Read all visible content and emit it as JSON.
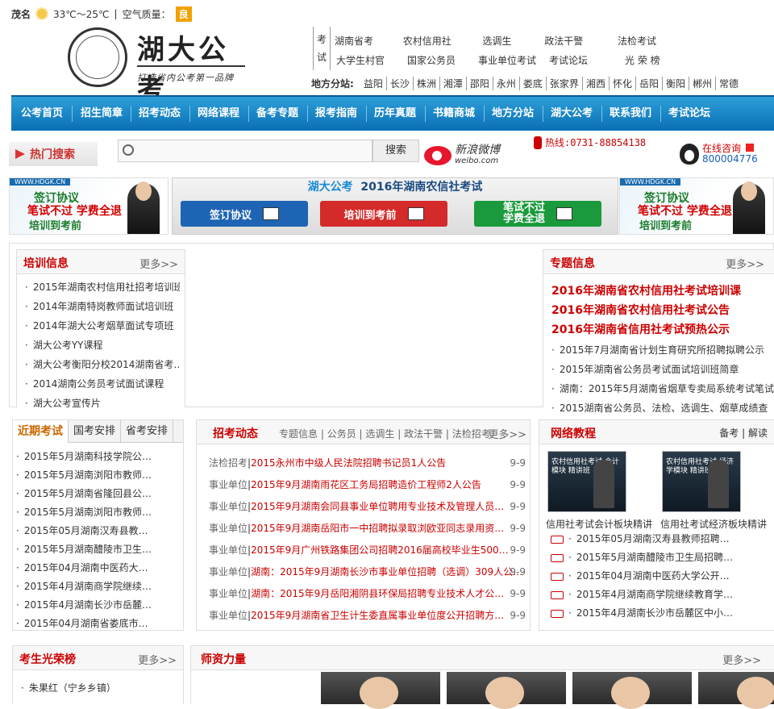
{
  "weather": {
    "city": "茂名",
    "temp": "33℃～25℃",
    "aq_label": "空气质量：",
    "aq_value": "良"
  },
  "logo": {
    "brand": "湖大公考",
    "slogan": "打造省内公考第一品牌"
  },
  "exam_label": [
    "考",
    "试"
  ],
  "topnav": {
    "row1": [
      "湖南省考",
      "农村信用社",
      "选调生",
      "政法干警",
      "法检考试"
    ],
    "row2": [
      "大学生村官",
      "国家公务员",
      "事业单位考试",
      "考试论坛",
      "光 荣 榜"
    ]
  },
  "region": {
    "label": "地方分站:",
    "cities": [
      "益阳",
      "长沙",
      "株洲",
      "湘潭",
      "邵阳",
      "永州",
      "娄底",
      "张家界",
      "湘西",
      "怀化",
      "岳阳",
      "衡阳",
      "郴州",
      "常德"
    ]
  },
  "mainnav": [
    "公考首页",
    "招生简章",
    "招考动态",
    "网络课程",
    "备考专题",
    "报考指南",
    "历年真题",
    "书籍商城",
    "地方分站",
    "湖大公考",
    "联系我们",
    "考试论坛"
  ],
  "search": {
    "hot": "热门搜索",
    "button": "搜索",
    "weibo_cn": "新浪微博",
    "weibo_en": "weibo.com",
    "hotline": "热线:0731-88854138",
    "qq_label": "在线咨询",
    "qq_num": "800004776"
  },
  "sidebanner": {
    "tag": "WWW.HDGK.CN",
    "t1": "签订协议",
    "t2": "笔试不过 学费全退",
    "t3": "培训到考前"
  },
  "cbanner": {
    "brand": "湖大公考",
    "title": "2016年湖南农信社考试",
    "btns": [
      "签订协议",
      "培训到考前",
      "笔试不过\n学费全退"
    ]
  },
  "colors": {
    "nav": "#0a6fb5",
    "accent": "#cc0000",
    "btn1": "#1e64b4",
    "btn2": "#d42a2a",
    "btn3": "#1a9a3c"
  },
  "training": {
    "title": "培训信息",
    "more": "更多>>",
    "items": [
      "2015年湖南农村信用社招考培训班",
      "2014年湖南特岗教师面试培训班",
      "2014年湖大公考烟草面试专项班",
      "湖大公考YY课程",
      "湖大公考衡阳分校2014湖南省考…",
      "2014湖南公务员考试面试课程",
      "湖大公考宣传片"
    ]
  },
  "special": {
    "title": "专题信息",
    "more": "更多>>",
    "big": [
      "2016年湖南省农村信用社考试培训课",
      "2016年湖南省农村信用社考试公告",
      "2016年湖南省信用社考试预热公示"
    ],
    "items": [
      "2015年7月湖南省计划生育研究所招聘拟聘公示",
      "2015年湖南省公务员考试面试培训班简章",
      "湖南：2015年5月湖南省烟草专卖局系统考试笔试",
      "2015湖南省公务员、法检、选调生、烟草成绩查"
    ]
  },
  "recent": {
    "tabs": [
      "近期考试",
      "国考安排",
      "省考安排"
    ],
    "items": [
      "2015年5月湖南科技学院公…",
      "2015年5月湖南浏阳市教师…",
      "2015年5月湖南省隆回县公…",
      "2015年5月湖南浏阳市教师…",
      "2015年05月湖南汉寿县教…",
      "2015年5月湖南醴陵市卫生…",
      "2015年04月湖南中医药大…",
      "2015年4月湖南商学院继续…",
      "2015年4月湖南长沙市岳麓…",
      "2015年04月湖南省娄底市…"
    ]
  },
  "dynamics": {
    "title": "招考动态",
    "subtabs": [
      "专题信息",
      "公务员",
      "选调生",
      "政法干警",
      "法检招考"
    ],
    "more": "更多>>",
    "items": [
      {
        "cat": "法检招考",
        "title": "2015永州市中级人民法院招聘书记员1人公告",
        "date": "9-9"
      },
      {
        "cat": "事业单位",
        "title": "2015年9月湖南雨花区工务局招聘造价工程师2人公告",
        "date": "9-9"
      },
      {
        "cat": "事业单位",
        "title": "2015年9月湖南会同县事业单位聘用专业技术及管理人员…",
        "date": "9-9"
      },
      {
        "cat": "事业单位",
        "title": "2015年9月湖南岳阳市一中招聘拟录取浏欧亚同志录用资…",
        "date": "9-9"
      },
      {
        "cat": "事业单位",
        "title": "2015年9月广州铁路集团公司招聘2016届高校毕业生500…",
        "date": "9-9"
      },
      {
        "cat": "事业单位",
        "title": "湖南：2015年9月湖南长沙市事业单位招聘（选调）309人公…",
        "date": "9-9"
      },
      {
        "cat": "事业单位",
        "title": "湖南：2015年9月岳阳湘阴县环保局招聘专业技术人才公…",
        "date": "9-9"
      },
      {
        "cat": "事业单位",
        "title": "2015年9月湖南省卫生计生委直属事业单位度公开招聘方…",
        "date": "9-9"
      }
    ]
  },
  "online": {
    "title": "网络教程",
    "links": [
      "备考",
      "解读"
    ],
    "thumbs": [
      {
        "img": "农村信用社考试 会计模块 精讲班",
        "cap": "信用社考试会计板块精讲"
      },
      {
        "img": "农村信用社考试 经济学模块 精讲班",
        "cap": "信用社考试经济板块精讲"
      }
    ],
    "items": [
      "2015年05月湖南汉寿县教师招聘…",
      "2015年5月湖南醴陵市卫生局招聘…",
      "2015年04月湖南中医药大学公开…",
      "2015年4月湖南商学院继续教育学…",
      "2015年4月湖南长沙市岳麓区中小…"
    ]
  },
  "honor": {
    "title": "考生光荣榜",
    "more": "更多>>",
    "items": [
      "朱果红（宁乡乡镇）"
    ]
  },
  "teachers": {
    "title": "师资力量",
    "more": "更多>>"
  }
}
